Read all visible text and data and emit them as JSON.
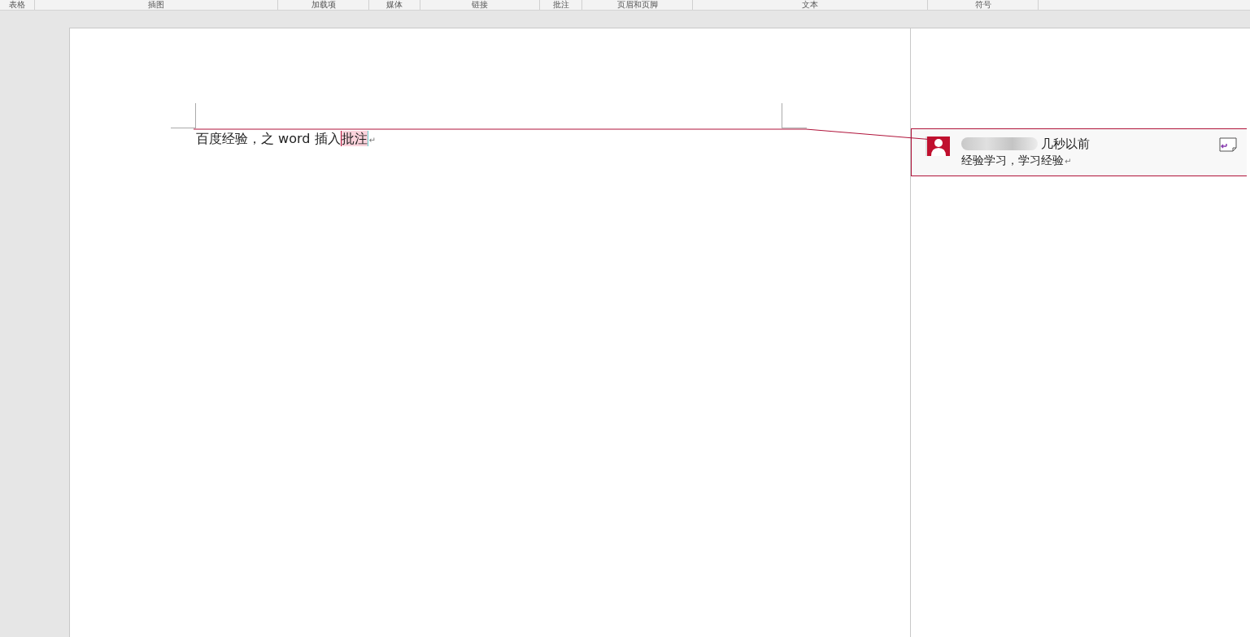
{
  "ribbon_groups": [
    {
      "label": "表格"
    },
    {
      "label": "插图"
    },
    {
      "label": "加载项"
    },
    {
      "label": "媒体"
    },
    {
      "label": "链接"
    },
    {
      "label": "批注"
    },
    {
      "label": "页眉和页脚"
    },
    {
      "label": "文本"
    },
    {
      "label": "符号"
    }
  ],
  "document": {
    "text_before": "百度经验，之 word 插入",
    "commented_text": "批注",
    "paragraph_mark": "↵"
  },
  "comment": {
    "time": "几秒以前",
    "body": "经验学习，学习经验",
    "paragraph_mark": "↵"
  }
}
